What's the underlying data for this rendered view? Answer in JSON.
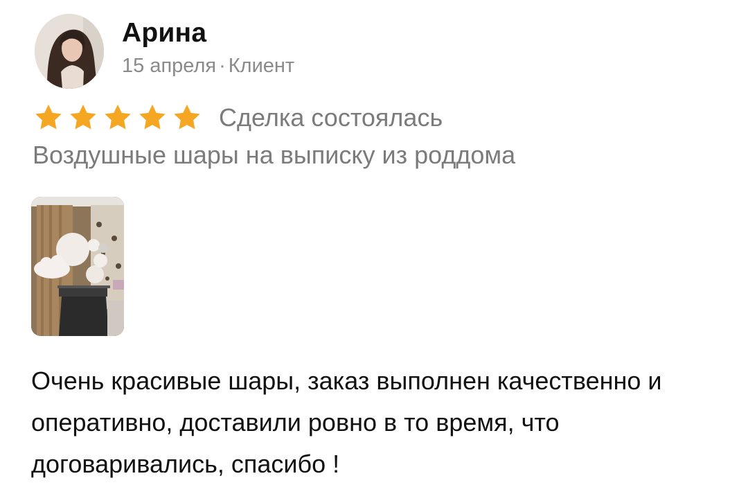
{
  "review": {
    "author": {
      "name": "Арина",
      "avatar_icon": "user-avatar-photo"
    },
    "date": "15 апреля",
    "separator": "·",
    "role": "Клиент",
    "rating": {
      "value": 5,
      "max": 5,
      "star_color": "#F5A623"
    },
    "deal_status": "Сделка состоялась",
    "service_title": "Воздушные шары на выписку из роддома",
    "photo_icon": "review-photo-balloons",
    "text": "Очень красивые шары, заказ выполнен качественно и оперативно, доставили ровно в то время, что договаривались, спасибо !"
  }
}
